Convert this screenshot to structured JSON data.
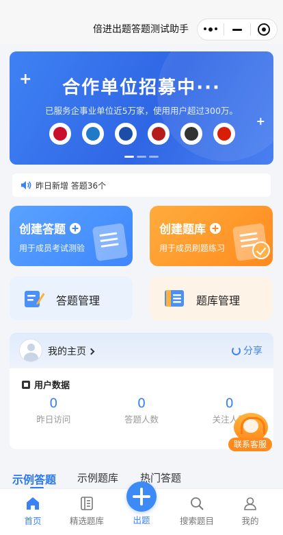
{
  "topbar": {
    "title": "倍进出题答题测试助手"
  },
  "capsule": {
    "more_icon": "more-dots-icon",
    "minimize_icon": "minimize-icon",
    "close_icon": "target-icon"
  },
  "banner": {
    "title_part1": "合作单位",
    "title_part2": "招募中",
    "title_dots": "···",
    "subtitle": "已服务企事业单位近5万家，使用用户超过300万。",
    "logos": [
      {
        "name": "emblem-logo",
        "color": "#c8102e"
      },
      {
        "name": "agency-logo",
        "color": "#1f7ac8"
      },
      {
        "name": "police-logo",
        "color": "#1a4ea8"
      },
      {
        "name": "fire-rescue-logo",
        "color": "#b71c1c"
      },
      {
        "name": "mascot-logo",
        "color": "#333333"
      },
      {
        "name": "league-logo",
        "color": "#d81e06"
      }
    ],
    "slides": 3,
    "active_slide": 0
  },
  "notice": {
    "icon": "speaker-icon",
    "text": "昨日新增 答题36个"
  },
  "cards": {
    "create_quiz": {
      "title": "创建答题",
      "subtitle": "用于成员考试测验"
    },
    "create_bank": {
      "title": "创建题库",
      "subtitle": "用于成员刷题练习"
    },
    "quiz_manage": {
      "label": "答题管理"
    },
    "bank_manage": {
      "label": "题库管理"
    }
  },
  "homepage": {
    "title": "我的主页",
    "share": "分享",
    "section": "用户数据",
    "stats": [
      {
        "value": "0",
        "label": "昨日访问"
      },
      {
        "value": "0",
        "label": "答题人数"
      },
      {
        "value": "0",
        "label": "关注人数"
      }
    ]
  },
  "service": {
    "label": "联系客服"
  },
  "tabs": [
    {
      "label": "示例答题",
      "active": true
    },
    {
      "label": "示例题库",
      "active": false
    },
    {
      "label": "热门答题",
      "active": false
    }
  ],
  "bottom_nav": [
    {
      "label": "首页",
      "icon": "home-icon",
      "active": true
    },
    {
      "label": "精选题库",
      "icon": "book-icon",
      "active": false
    },
    {
      "label": "出题",
      "icon": "plus-icon",
      "active": false
    },
    {
      "label": "搜索题目",
      "icon": "search-icon",
      "active": false
    },
    {
      "label": "我的",
      "icon": "user-icon",
      "active": false
    }
  ],
  "colors": {
    "primary": "#3b82f6",
    "orange": "#ff8a1e"
  }
}
